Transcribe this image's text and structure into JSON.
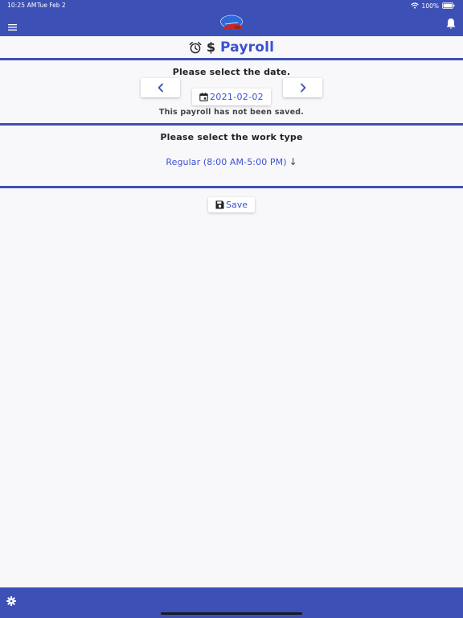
{
  "status_bar": {
    "time": "10:25 AM",
    "date": "Tue Feb 2",
    "battery": "100%"
  },
  "header": {
    "menu_icon": "menu-icon",
    "logo_icon": "logo-icon",
    "bell_icon": "bell-icon"
  },
  "title": {
    "text": "Payroll",
    "alarm_icon": "alarm-clock-icon",
    "dollar_symbol": "$"
  },
  "date_section": {
    "label": "Please select the date.",
    "prev_icon": "chevron-left-icon",
    "next_icon": "chevron-right-icon",
    "calendar_icon": "calendar-icon",
    "date_value": "2021-02-02",
    "save_status": "This payroll has not been saved."
  },
  "work_type_section": {
    "label": "Please select the work type",
    "selected_value": "Regular (8:00 AM-5:00 PM)",
    "arrow_symbol": "↓"
  },
  "save_button": {
    "icon": "floppy-disk-icon",
    "label": "Save"
  },
  "footer": {
    "settings_icon": "gear-icon"
  },
  "colors": {
    "primary": "#3d50b6",
    "accent_text": "#3d50d2",
    "background": "#f8f8fa"
  }
}
